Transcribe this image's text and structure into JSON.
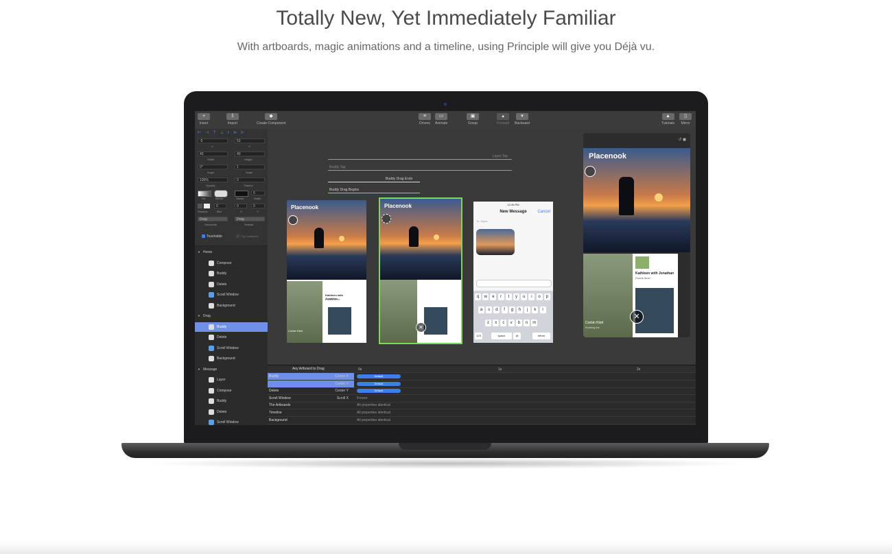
{
  "hero": {
    "title": "Totally New, Yet Immediately Familiar",
    "subtitle": "With artboards, magic animations and a timeline, using Principle will give you Déjà vu."
  },
  "toolbar": {
    "insert": "Insert",
    "import": "Import",
    "create_component": "Create Component",
    "drivers": "Drivers",
    "animate": "Animate",
    "group": "Group",
    "forward": "Forward",
    "backward": "Backward",
    "tutorials": "Tutorials",
    "mirror": "Mirror"
  },
  "inspector": {
    "x_value": "-5",
    "x_label": "X",
    "y_value": "53",
    "y_label": "Y",
    "width_value": "40",
    "width_label": "Width",
    "height_value": "40",
    "height_label": "Height",
    "angle_value": "0°",
    "angle_label": "Angle",
    "scale_value": "1",
    "scale_label": "Scale",
    "opacity_value": "100%",
    "opacity_label": "Opacity",
    "radius_value": "0",
    "radius_label": "Radius",
    "fill_label": "Fill",
    "media_label": "Media",
    "stroke_label": "Stroke",
    "width2_label": "Width",
    "width2_value": "0",
    "shadow_label": "Shadow",
    "blur_label": "Blur",
    "blur_value": "0",
    "sx_label": "X",
    "sx_value": "0",
    "sy_label": "Y",
    "sy_value": "0",
    "horizontal_value": "Drag",
    "horizontal_label": "Horizontal",
    "vertical_value": "Drag",
    "vertical_label": "Vertical",
    "touchable": "Touchable",
    "clip": "Clip Sublayers"
  },
  "layers": [
    {
      "label": "Home",
      "type": "group"
    },
    {
      "label": "Compose",
      "type": "layer"
    },
    {
      "label": "Buddy",
      "type": "layer"
    },
    {
      "label": "Delete",
      "type": "layer"
    },
    {
      "label": "Scroll Window",
      "type": "folder"
    },
    {
      "label": "Background",
      "type": "layer"
    },
    {
      "label": "Drag",
      "type": "group"
    },
    {
      "label": "Buddy",
      "type": "layer",
      "selected": true
    },
    {
      "label": "Delete",
      "type": "layer"
    },
    {
      "label": "Scroll Window",
      "type": "folder"
    },
    {
      "label": "Background",
      "type": "layer"
    },
    {
      "label": "Message",
      "type": "group"
    },
    {
      "label": "Layer",
      "type": "layer"
    },
    {
      "label": "Compose",
      "type": "layer"
    },
    {
      "label": "Buddy",
      "type": "layer"
    },
    {
      "label": "Delete",
      "type": "layer"
    },
    {
      "label": "Scroll Window",
      "type": "folder"
    }
  ],
  "canvas": {
    "arrows": [
      "Layer Tap",
      "Buddy Tap",
      "Buddy Drag Ends",
      "Buddy Drag Begins"
    ],
    "app_name": "Placenook",
    "card_name": "Kathleen with Jonathan",
    "card_sub": "Puzzle time!",
    "photo_name": "Corbin Klett",
    "photo_sub": "Building the",
    "message": {
      "time": "12:36 PM",
      "title": "New Message",
      "cancel": "Cancel",
      "to": "To: Dylan"
    },
    "keyboard_rows": [
      [
        "q",
        "w",
        "e",
        "r",
        "t",
        "y",
        "u",
        "i",
        "o",
        "p"
      ],
      [
        "a",
        "s",
        "d",
        "f",
        "g",
        "h",
        "j",
        "k",
        "l"
      ],
      [
        "z",
        "x",
        "c",
        "v",
        "b",
        "n",
        "m"
      ]
    ],
    "kb_num": "123",
    "kb_space": "space",
    "kb_at": "@",
    "kb_return": "return"
  },
  "timeline": {
    "header": "Any Artboard to Drag",
    "ticks": [
      "0s",
      "1s",
      "2s"
    ],
    "rows": [
      {
        "name": "Buddy",
        "prop": "Center X",
        "note": "Default",
        "pill": true,
        "selected": true
      },
      {
        "name": "",
        "prop": "Center Y",
        "note": "Default",
        "pill": true,
        "selected": true
      },
      {
        "name": "Delete",
        "prop": "Center Y",
        "note": "Default",
        "pill": true
      },
      {
        "name": "Scroll Window",
        "prop": "Scroll X",
        "note": "Frozen",
        "pill": false
      },
      {
        "name": "The Artboards",
        "prop": "",
        "note": "All properties identical",
        "pill": false
      },
      {
        "name": "Timeline",
        "prop": "",
        "note": "All properties identical",
        "pill": false
      },
      {
        "name": "Background",
        "prop": "",
        "note": "All properties identical",
        "pill": false
      }
    ]
  }
}
